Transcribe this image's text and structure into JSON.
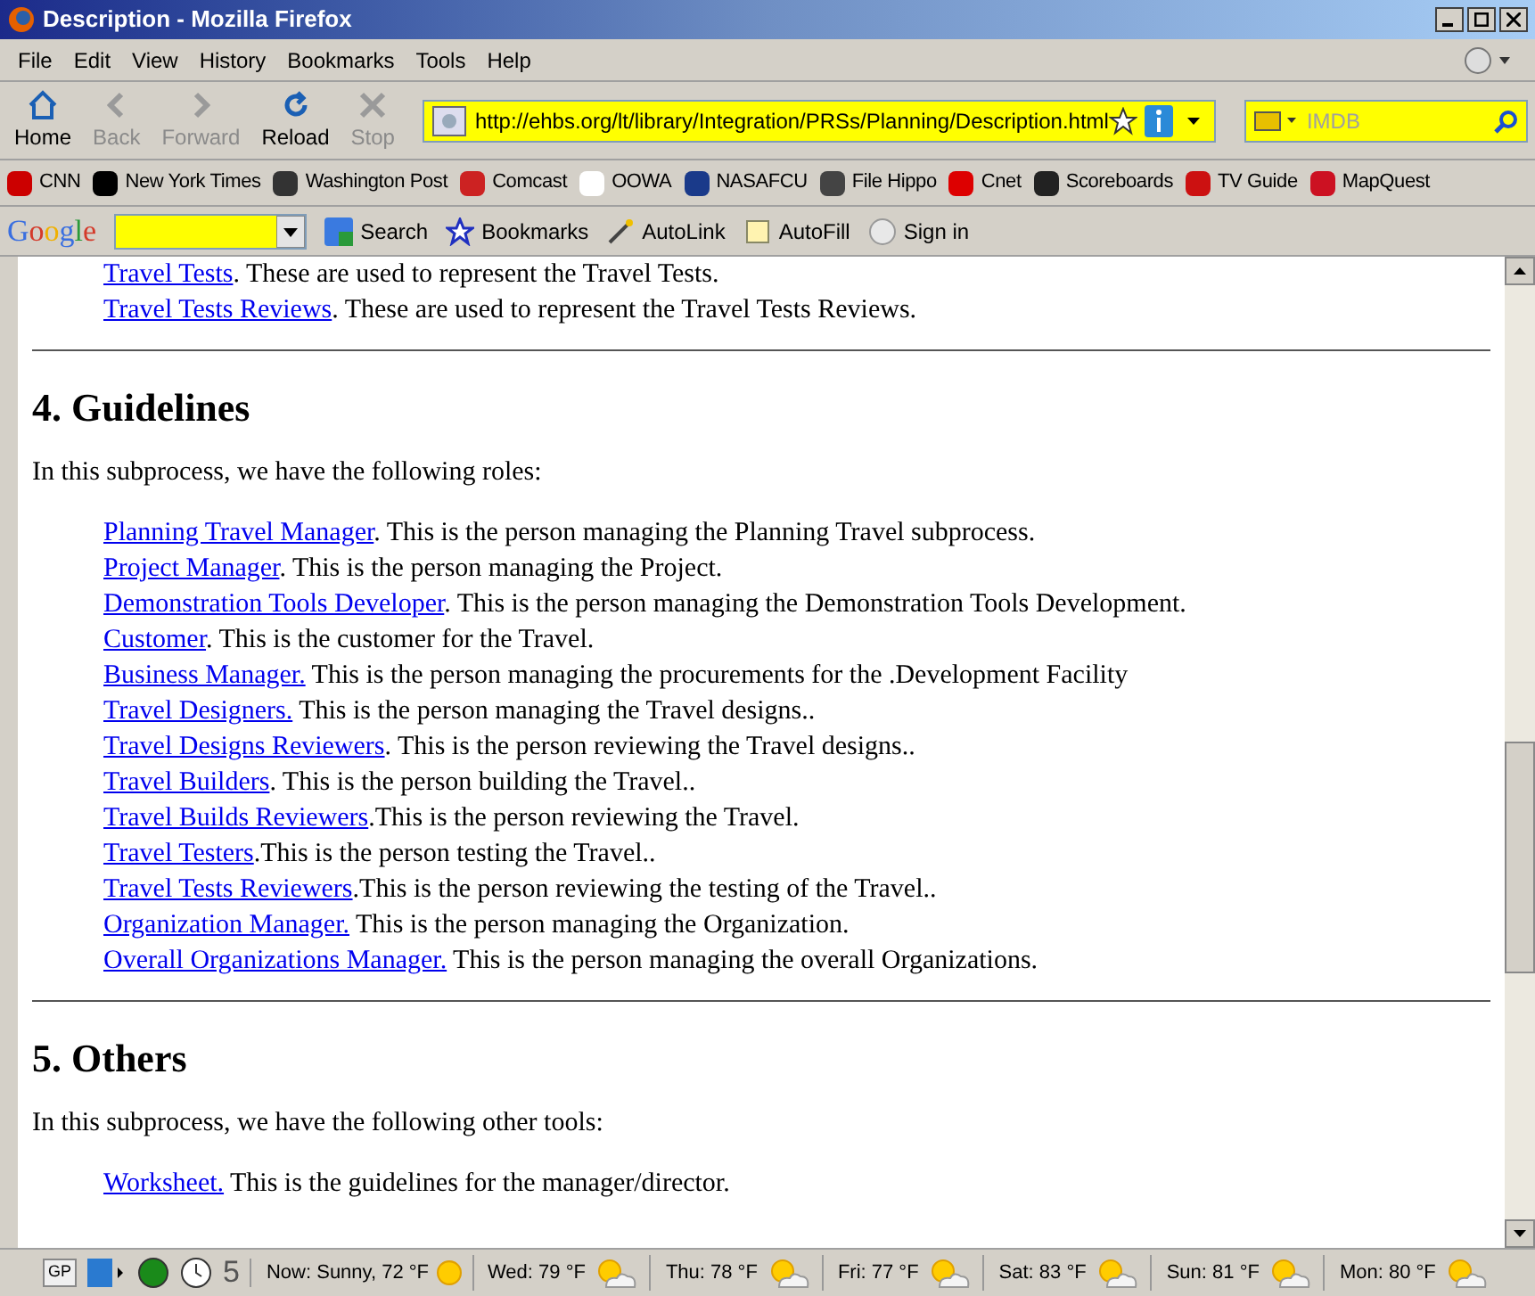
{
  "window": {
    "title": "Description - Mozilla Firefox"
  },
  "menu": [
    "File",
    "Edit",
    "View",
    "History",
    "Bookmarks",
    "Tools",
    "Help"
  ],
  "nav_buttons": [
    {
      "label": "Home",
      "kind": "home",
      "disabled": false
    },
    {
      "label": "Back",
      "kind": "back",
      "disabled": true
    },
    {
      "label": "Forward",
      "kind": "forward",
      "disabled": true
    },
    {
      "label": "Reload",
      "kind": "reload",
      "disabled": false
    },
    {
      "label": "Stop",
      "kind": "stop",
      "disabled": true
    }
  ],
  "address": {
    "value": "http://ehbs.org/lt/library/Integration/PRSs/Planning/Description.html"
  },
  "search": {
    "placeholder": "IMDB"
  },
  "bookmarks": [
    {
      "label": "CNN",
      "color": "#cc0000"
    },
    {
      "label": "New York Times",
      "color": "#000000"
    },
    {
      "label": "Washington Post",
      "color": "#333333"
    },
    {
      "label": "Comcast",
      "color": "#cc2222"
    },
    {
      "label": "OOWA",
      "color": "#ffffff"
    },
    {
      "label": "NASAFCU",
      "color": "#1a3a8a"
    },
    {
      "label": "File Hippo",
      "color": "#444444"
    },
    {
      "label": "Cnet",
      "color": "#dd0000"
    },
    {
      "label": "Scoreboards",
      "color": "#222222"
    },
    {
      "label": "TV Guide",
      "color": "#cc1111"
    },
    {
      "label": "MapQuest",
      "color": "#cc1122"
    }
  ],
  "google_toolbar": {
    "logo": "Google",
    "items": [
      {
        "label": "Search",
        "kind": "search"
      },
      {
        "label": "Bookmarks",
        "kind": "bookmarks"
      },
      {
        "label": "AutoLink",
        "kind": "autolink"
      },
      {
        "label": "AutoFill",
        "kind": "autofill"
      },
      {
        "label": "Sign in",
        "kind": "signin"
      }
    ]
  },
  "content": {
    "top_items": [
      {
        "link": "Travel Tests",
        "text": ". These are used to represent the Travel Tests."
      },
      {
        "link": "Travel Tests Reviews",
        "text": ". These are used to represent the Travel Tests Reviews."
      }
    ],
    "sections": [
      {
        "heading": "4. Guidelines",
        "intro": "In this subprocess, we have the following roles:",
        "items": [
          {
            "link": "Planning Travel Manager",
            "text": ". This is the person managing the Planning Travel subprocess."
          },
          {
            "link": "Project Manager",
            "text": ". This is the person managing the Project."
          },
          {
            "link": "Demonstration Tools Developer",
            "text": ". This is the person managing the Demonstration Tools Development."
          },
          {
            "link": "Customer",
            "text": ". This is the customer for the Travel."
          },
          {
            "link": "Business Manager.",
            "text": " This is the person managing the procurements for the .Development Facility"
          },
          {
            "link": "Travel Designers.",
            "text": " This is the person managing the Travel designs.."
          },
          {
            "link": "Travel Designs Reviewers",
            "text": ". This is the person reviewing the Travel designs.."
          },
          {
            "link": "Travel Builders",
            "text": ". This is the person building the Travel.."
          },
          {
            "link": "Travel Builds Reviewers",
            "text": ".This is the person reviewing the Travel."
          },
          {
            "link": "Travel Testers",
            "text": ".This is the person testing the Travel.."
          },
          {
            "link": "Travel Tests Reviewers",
            "text": ".This is the person reviewing the testing of the Travel.."
          },
          {
            "link": "Organization Manager.",
            "text": " This is the person managing the Organization."
          },
          {
            "link": "Overall Organizations Manager.",
            "text": " This is the person managing the overall Organizations."
          }
        ]
      },
      {
        "heading": "5. Others",
        "intro": "In this subprocess, we have the following other tools:",
        "items": [
          {
            "link": "Worksheet.",
            "text": " This is the guidelines for the manager/director."
          }
        ]
      }
    ]
  },
  "status_bar": {
    "badge": "GP",
    "count": "5",
    "weather": [
      {
        "label": "Now: Sunny, 72 °F",
        "kind": "sunny"
      },
      {
        "label": "Wed: 79 °F",
        "kind": "partly"
      },
      {
        "label": "Thu: 78 °F",
        "kind": "partly"
      },
      {
        "label": "Fri: 77 °F",
        "kind": "partly"
      },
      {
        "label": "Sat: 83 °F",
        "kind": "partly"
      },
      {
        "label": "Sun: 81 °F",
        "kind": "partly"
      },
      {
        "label": "Mon: 80 °F",
        "kind": "partly"
      }
    ]
  }
}
